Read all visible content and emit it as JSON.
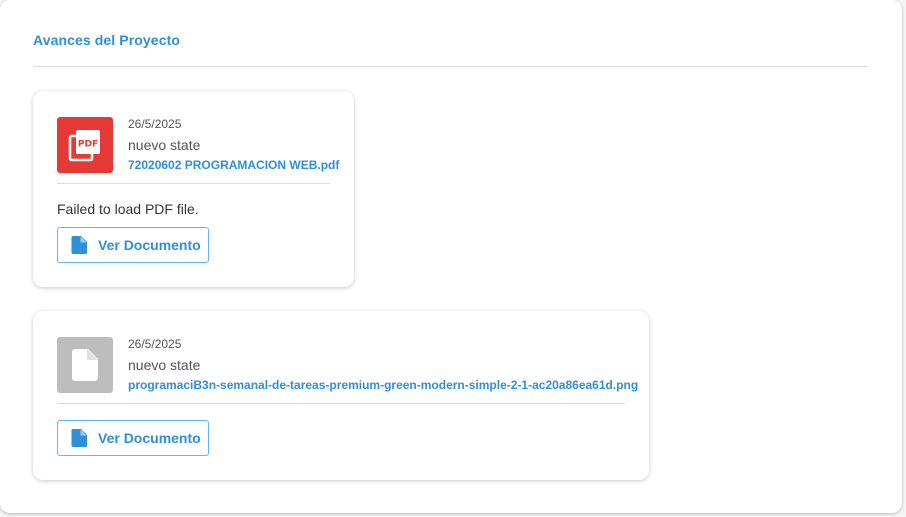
{
  "section": {
    "title": "Avances del Proyecto"
  },
  "cards": [
    {
      "date": "26/5/2025",
      "state": "nuevo state",
      "filename": "72020602 PROGRAMACION WEB.pdf",
      "preview_message": "Failed to load PDF file.",
      "button_label": "Ver Documento",
      "thumb_icon": "pdf-icon",
      "thumb_color": "#e53935"
    },
    {
      "date": "26/5/2025",
      "state": "nuevo state",
      "filename": "programaciB3n-semanal-de-tareas-premium-green-modern-simple-2-1-ac20a86ea61d.png",
      "button_label": "Ver Documento",
      "thumb_icon": "file-icon",
      "thumb_color": "#bdbdbd"
    }
  ],
  "colors": {
    "accent": "#2f8fd8",
    "button_border": "#64b5f6"
  }
}
